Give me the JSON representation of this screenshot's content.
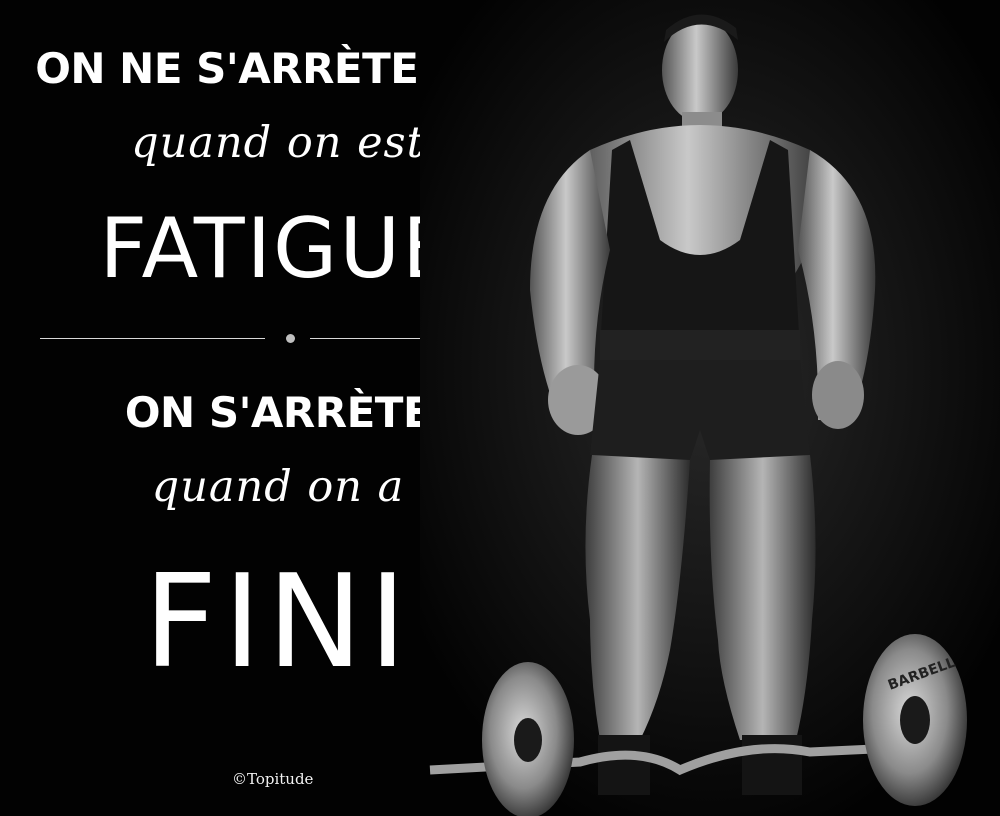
{
  "quote": {
    "line1": "ON NE S'ARRÈTE PAS",
    "line2": "quand on est",
    "line3": "FATIGUÉ",
    "line4": "ON S'ARRÈTE",
    "line5": "quand on a",
    "line6": "FINI"
  },
  "copyright": "©Topitude",
  "photo": {
    "subject": "bodybuilder standing behind barbell",
    "barbell_plate_text": "BARBELL"
  },
  "colors": {
    "background": "#020202",
    "text": "#ffffff",
    "divider": "#d8d8d8"
  }
}
